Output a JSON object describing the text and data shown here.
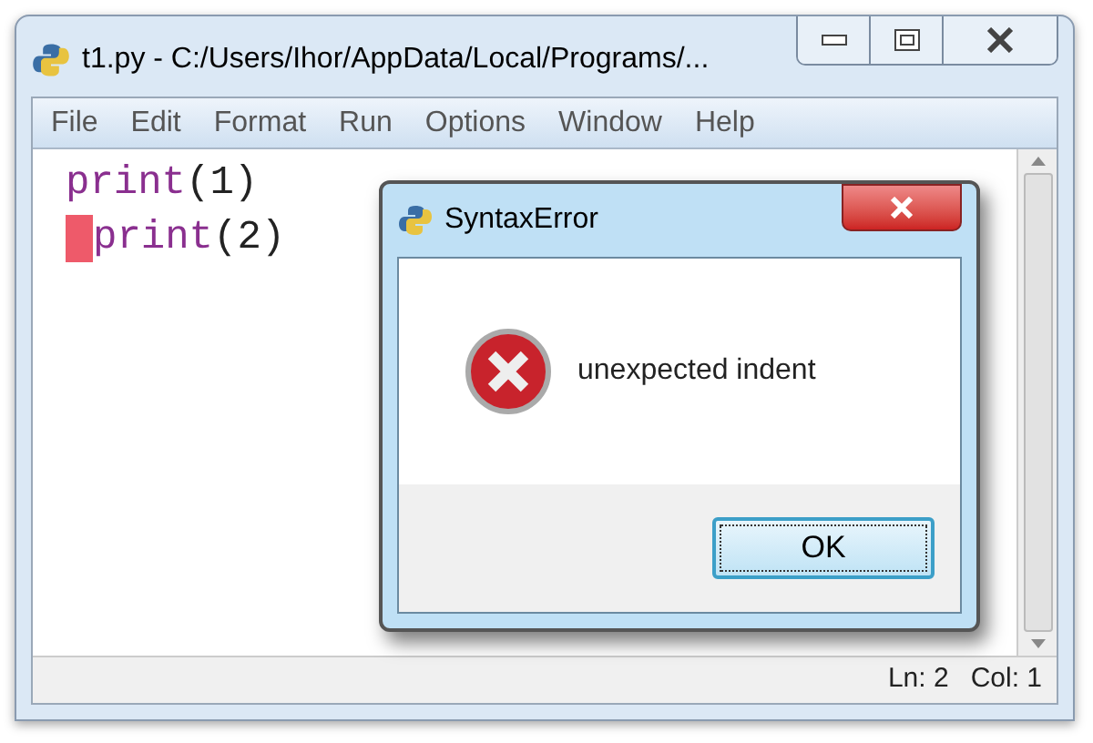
{
  "window": {
    "title": "t1.py - C:/Users/Ihor/AppData/Local/Programs/..."
  },
  "menu": [
    "File",
    "Edit",
    "Format",
    "Run",
    "Options",
    "Window",
    "Help"
  ],
  "editor": {
    "lines": [
      {
        "error_mark": false,
        "tokens": [
          {
            "kind": "builtin",
            "text": "print"
          },
          {
            "kind": "plain",
            "text": "(1)"
          }
        ]
      },
      {
        "error_mark": true,
        "tokens": [
          {
            "kind": "builtin",
            "text": "print"
          },
          {
            "kind": "plain",
            "text": "(2)"
          }
        ]
      }
    ]
  },
  "dialog": {
    "title": "SyntaxError",
    "message": "unexpected indent",
    "buttons": [
      {
        "label": "OK",
        "focused": true
      }
    ]
  },
  "status_bar": {
    "line": "Ln: 2",
    "column": "Col: 1"
  }
}
